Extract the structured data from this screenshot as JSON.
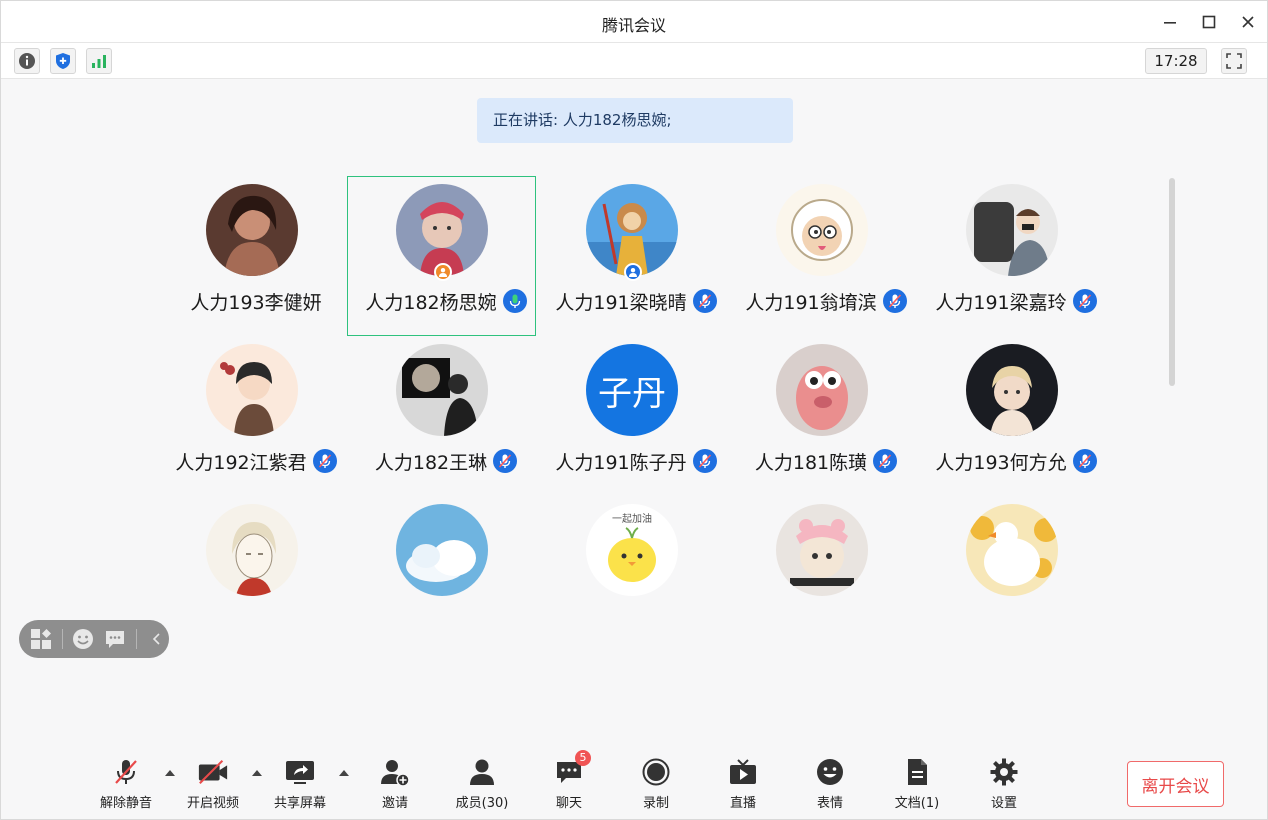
{
  "window": {
    "title": "腾讯会议"
  },
  "toolbar": {
    "time": "17:28",
    "icons": [
      "info-icon",
      "shield-icon",
      "signal-icon",
      "fullscreen-icon"
    ]
  },
  "speaking": {
    "text": "正在讲话: 人力182杨思婉;"
  },
  "participants": [
    {
      "name": "人力193李健妍",
      "mic": "none",
      "avatar": "photo-dark"
    },
    {
      "name": "人力182杨思婉",
      "mic": "speaking",
      "avatar": "doll",
      "active": true,
      "badge": "host"
    },
    {
      "name": "人力191梁晓晴",
      "mic": "muted",
      "avatar": "monkey",
      "badge": "cohost"
    },
    {
      "name": "人力191翁堉滨",
      "mic": "muted",
      "avatar": "sheep"
    },
    {
      "name": "人力191梁嘉玲",
      "mic": "muted",
      "avatar": "chair"
    },
    {
      "name": "人力192江紫君",
      "mic": "muted",
      "avatar": "girl"
    },
    {
      "name": "人力182王琳",
      "mic": "muted",
      "avatar": "moon"
    },
    {
      "name": "人力191陈子丹",
      "mic": "muted",
      "avatar": "text",
      "avatar_text": "子丹"
    },
    {
      "name": "人力181陈璜",
      "mic": "muted",
      "avatar": "pink"
    },
    {
      "name": "人力193何方允",
      "mic": "muted",
      "avatar": "child"
    },
    {
      "name": "",
      "mic": "none",
      "avatar": "sketch"
    },
    {
      "name": "",
      "mic": "none",
      "avatar": "cloud"
    },
    {
      "name": "",
      "mic": "none",
      "avatar": "chick",
      "avatar_caption": "一起加油"
    },
    {
      "name": "",
      "mic": "none",
      "avatar": "cat"
    },
    {
      "name": "",
      "mic": "none",
      "avatar": "duck"
    }
  ],
  "bottom": {
    "unmute": "解除静音",
    "video": "开启视频",
    "share": "共享屏幕",
    "invite": "邀请",
    "members": "成员(30)",
    "chat": "聊天",
    "chat_badge": "5",
    "record": "录制",
    "live": "直播",
    "emoji": "表情",
    "docs": "文档(1)",
    "settings": "设置",
    "leave": "离开会议"
  },
  "colors": {
    "accent": "#1f6fe0",
    "active_border": "#2ec27e",
    "leave": "#e84a4a",
    "speaking_bg": "#dbe9fb"
  }
}
